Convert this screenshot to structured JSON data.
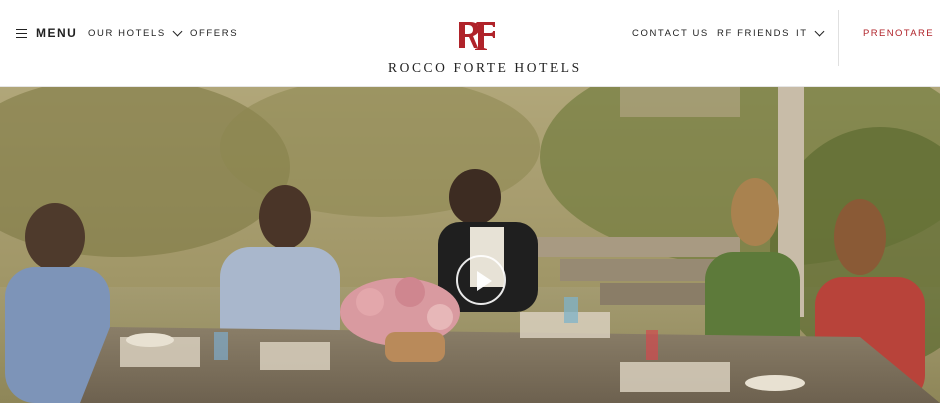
{
  "header": {
    "menu_label": "MENU",
    "nav_left": [
      {
        "label": "OUR HOTELS"
      },
      {
        "label": "OFFERS"
      }
    ],
    "logo": {
      "monogram": "RF",
      "brand": "ROCCO FORTE HOTELS"
    },
    "nav_right": [
      {
        "label": "CONTACT US"
      },
      {
        "label": "RF FRIENDS"
      },
      {
        "label": "IT"
      }
    ],
    "book_label": "PRENOTARE"
  },
  "colors": {
    "brand_red": "#b0232a",
    "text": "#222222"
  },
  "hero": {
    "media": "garden dining scene",
    "play_icon": "play-icon"
  }
}
